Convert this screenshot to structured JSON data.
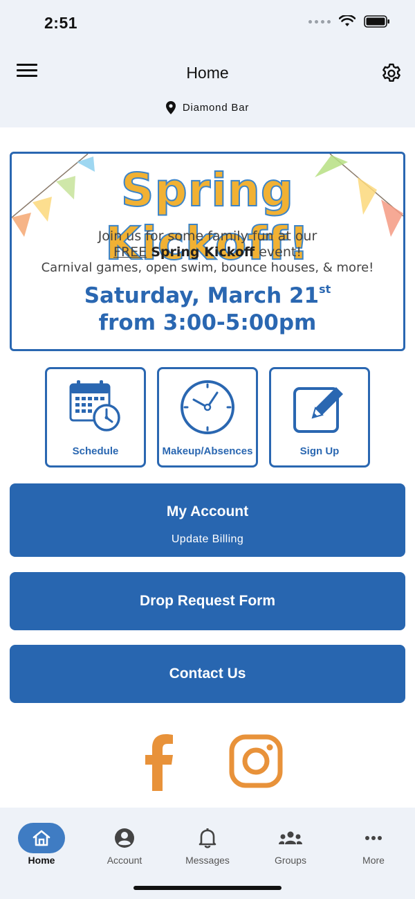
{
  "status": {
    "time": "2:51"
  },
  "header": {
    "title": "Home",
    "location": "Diamond Bar"
  },
  "banner": {
    "title": "Spring Kickoff!",
    "line1": "Join us for some family fun at our",
    "line2_free": "FREE",
    "line2_event": "Spring Kickoff",
    "line2_rest": "event!",
    "line3": "Carnival games, open swim, bounce houses, & more!",
    "date": "Saturday, March 21",
    "date_suffix": "st",
    "time": "from 3:00-5:00pm"
  },
  "tiles": [
    {
      "label": "Schedule",
      "icon": "calendar-clock-icon"
    },
    {
      "label": "Makeup/Absences",
      "icon": "clock-icon"
    },
    {
      "label": "Sign Up",
      "icon": "edit-icon"
    }
  ],
  "buttons": {
    "account_main": "My Account",
    "account_sub": "Update Billing",
    "drop": "Drop Request Form",
    "contact": "Contact Us"
  },
  "social": {
    "facebook": "facebook-icon",
    "instagram": "instagram-icon"
  },
  "tabbar": [
    {
      "label": "Home",
      "icon": "home-icon",
      "active": true
    },
    {
      "label": "Account",
      "icon": "account-icon",
      "active": false
    },
    {
      "label": "Messages",
      "icon": "bell-icon",
      "active": false
    },
    {
      "label": "Groups",
      "icon": "groups-icon",
      "active": false
    },
    {
      "label": "More",
      "icon": "more-icon",
      "active": false
    }
  ],
  "colors": {
    "primary": "#2866b0",
    "accent_orange": "#e8923a",
    "header_bg": "#eef2f8"
  }
}
